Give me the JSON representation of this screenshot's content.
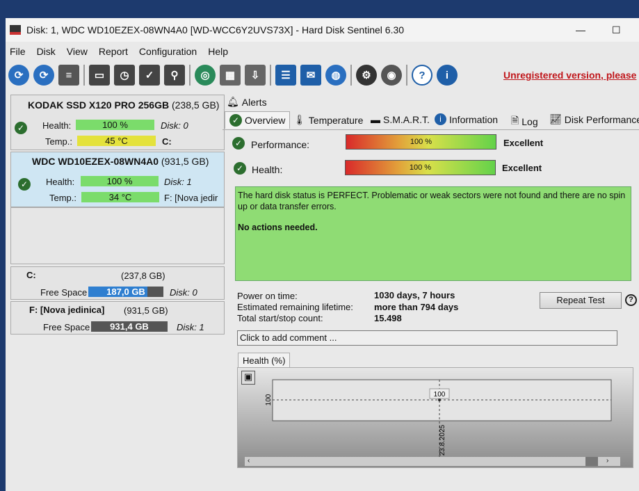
{
  "window": {
    "title": "Disk: 1, WDC WD10EZEX-08WN4A0 [WD-WCC6Y2UVS73X]  -  Hard Disk Sentinel 6.30",
    "maximize": "☐"
  },
  "menu": [
    "File",
    "Disk",
    "View",
    "Report",
    "Configuration",
    "Help"
  ],
  "toolbar": {
    "unregistered": "Unregistered version, please"
  },
  "disks": [
    {
      "name": "KODAK SSD X120 PRO 256GB",
      "size": "(238,5 GB)",
      "health_label": "Health:",
      "health": "100 %",
      "health_pct": 100,
      "temp_label": "Temp.:",
      "temp": "45 °C",
      "disk": "Disk: 0",
      "drive": "C:"
    },
    {
      "name": "WDC WD10EZEX-08WN4A0",
      "size": "(931,5 GB)",
      "health_label": "Health:",
      "health": "100 %",
      "health_pct": 100,
      "temp_label": "Temp.:",
      "temp": "34 °C",
      "disk": "Disk: 1",
      "drive": "F: [Nova jedir"
    }
  ],
  "volumes": [
    {
      "name": "C:",
      "size": "(237,8 GB)",
      "free_label": "Free Space",
      "free": "187,0 GB",
      "free_fraction": 0.79,
      "disk": "Disk: 0"
    },
    {
      "name": "F: [Nova jedinica]",
      "size": "(931,5 GB)",
      "free_label": "Free Space",
      "free": "931,4 GB",
      "free_fraction": 1.0,
      "disk": "Disk: 1"
    }
  ],
  "tabs": {
    "alerts": "Alerts",
    "overview": "Overview",
    "temperature": "Temperature",
    "smart": "S.M.A.R.T.",
    "information": "Information",
    "log": "Log",
    "performance": "Disk Performance"
  },
  "overview": {
    "performance_label": "Performance:",
    "performance": "100 %",
    "performance_pct": 100,
    "performance_rating": "Excellent",
    "health_label": "Health:",
    "health": "100 %",
    "health_pct": 100,
    "health_rating": "Excellent",
    "status_text": "The hard disk status is PERFECT. Problematic or weak sectors were not found and there are no spin up or data transfer errors.",
    "actions": "No actions needed.",
    "power_on_label": "Power on time:",
    "power_on": "1030 days, 7 hours",
    "lifetime_label": "Estimated remaining lifetime:",
    "lifetime": "more than 794 days",
    "startstop_label": "Total start/stop count:",
    "startstop": "15.498",
    "repeat_test": "Repeat Test",
    "comment_placeholder": "Click to add comment ..."
  },
  "chart_data": {
    "type": "line",
    "title": "Health (%)",
    "x": [
      "23.8.2025"
    ],
    "values": [
      100
    ],
    "y_tick": "100",
    "point_label": "100"
  },
  "colors": {
    "accent_green": "#7bdc6b",
    "status_bg": "#8fdc74",
    "unregistered": "#c0151a"
  }
}
